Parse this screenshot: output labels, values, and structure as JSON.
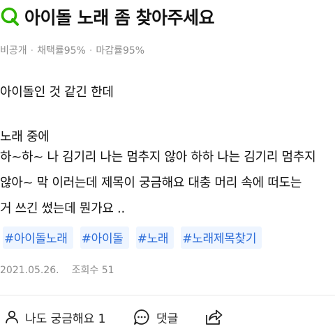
{
  "question": {
    "icon": "q-icon",
    "title": "아이돌 노래 좀 찾아주세요"
  },
  "meta": {
    "visibility": "비공개",
    "adopt_rate": "채택률95%",
    "close_rate": "마감률95%"
  },
  "body": {
    "lines": [
      "아이돌인 것 같긴 한데",
      "노래 중에",
      "하~하~ 나 김기리 나는 멈추지 않아 하하 나는 김기리 멈추지",
      "않아~ 막 이러는데 제목이 궁금해요 대충 머리 속에 떠도는",
      "거 쓰긴 썼는데 뭔가요 .."
    ]
  },
  "tags": [
    "#아이돌노래",
    "#아이돌",
    "#노래",
    "#노래제목찾기"
  ],
  "info": {
    "date": "2021.05.26.",
    "views": "조회수 51"
  },
  "actions": {
    "curious": {
      "icon": "person-icon",
      "label": "나도 궁금해요 1"
    },
    "comment": {
      "icon": "comment-icon",
      "label": "댓글"
    },
    "share": {
      "icon": "share-icon"
    }
  },
  "colors": {
    "q_green": "#2db400",
    "tag_text": "#2a6bd8",
    "tag_bg": "#eef5ff",
    "meta_gray": "#8c8c8c"
  }
}
